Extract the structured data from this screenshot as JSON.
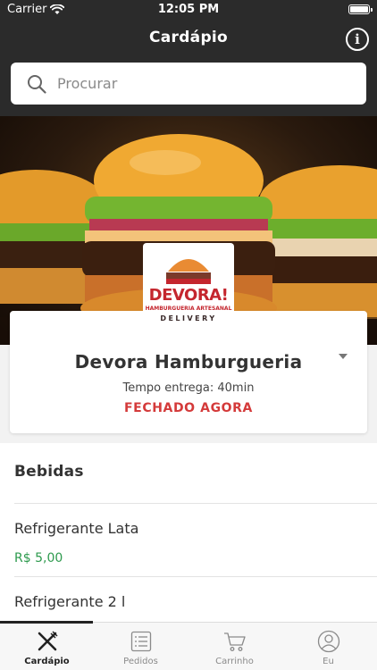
{
  "status_bar": {
    "carrier": "Carrier",
    "time": "12:05 PM"
  },
  "header": {
    "title": "Cardápio",
    "info_icon": "info-icon"
  },
  "search": {
    "placeholder": "Procurar",
    "icon": "search-icon"
  },
  "restaurant": {
    "logo_text": "DEVORA!",
    "logo_subtitle": "HAMBURGUERIA ARTESANAL",
    "logo_delivery": "DELIVERY",
    "name": "Devora Hamburgueria",
    "delivery_time": "Tempo entrega: 40min",
    "status": "FECHADO AGORA"
  },
  "menu": {
    "category": "Bebidas",
    "items": [
      {
        "name": "Refrigerante Lata",
        "price": "R$ 5,00"
      },
      {
        "name": "Refrigerante 2 l"
      }
    ]
  },
  "tabbar": {
    "tabs": [
      {
        "label": "Cardápio",
        "icon": "fork-knife-icon",
        "active": true
      },
      {
        "label": "Pedidos",
        "icon": "list-icon",
        "active": false
      },
      {
        "label": "Carrinho",
        "icon": "cart-icon",
        "active": false
      },
      {
        "label": "Eu",
        "icon": "user-icon",
        "active": false
      }
    ]
  },
  "colors": {
    "header_bg": "#2b2b2b",
    "status_closed": "#d43a3a",
    "price": "#2e9a4e",
    "logo_red": "#c4262e"
  }
}
